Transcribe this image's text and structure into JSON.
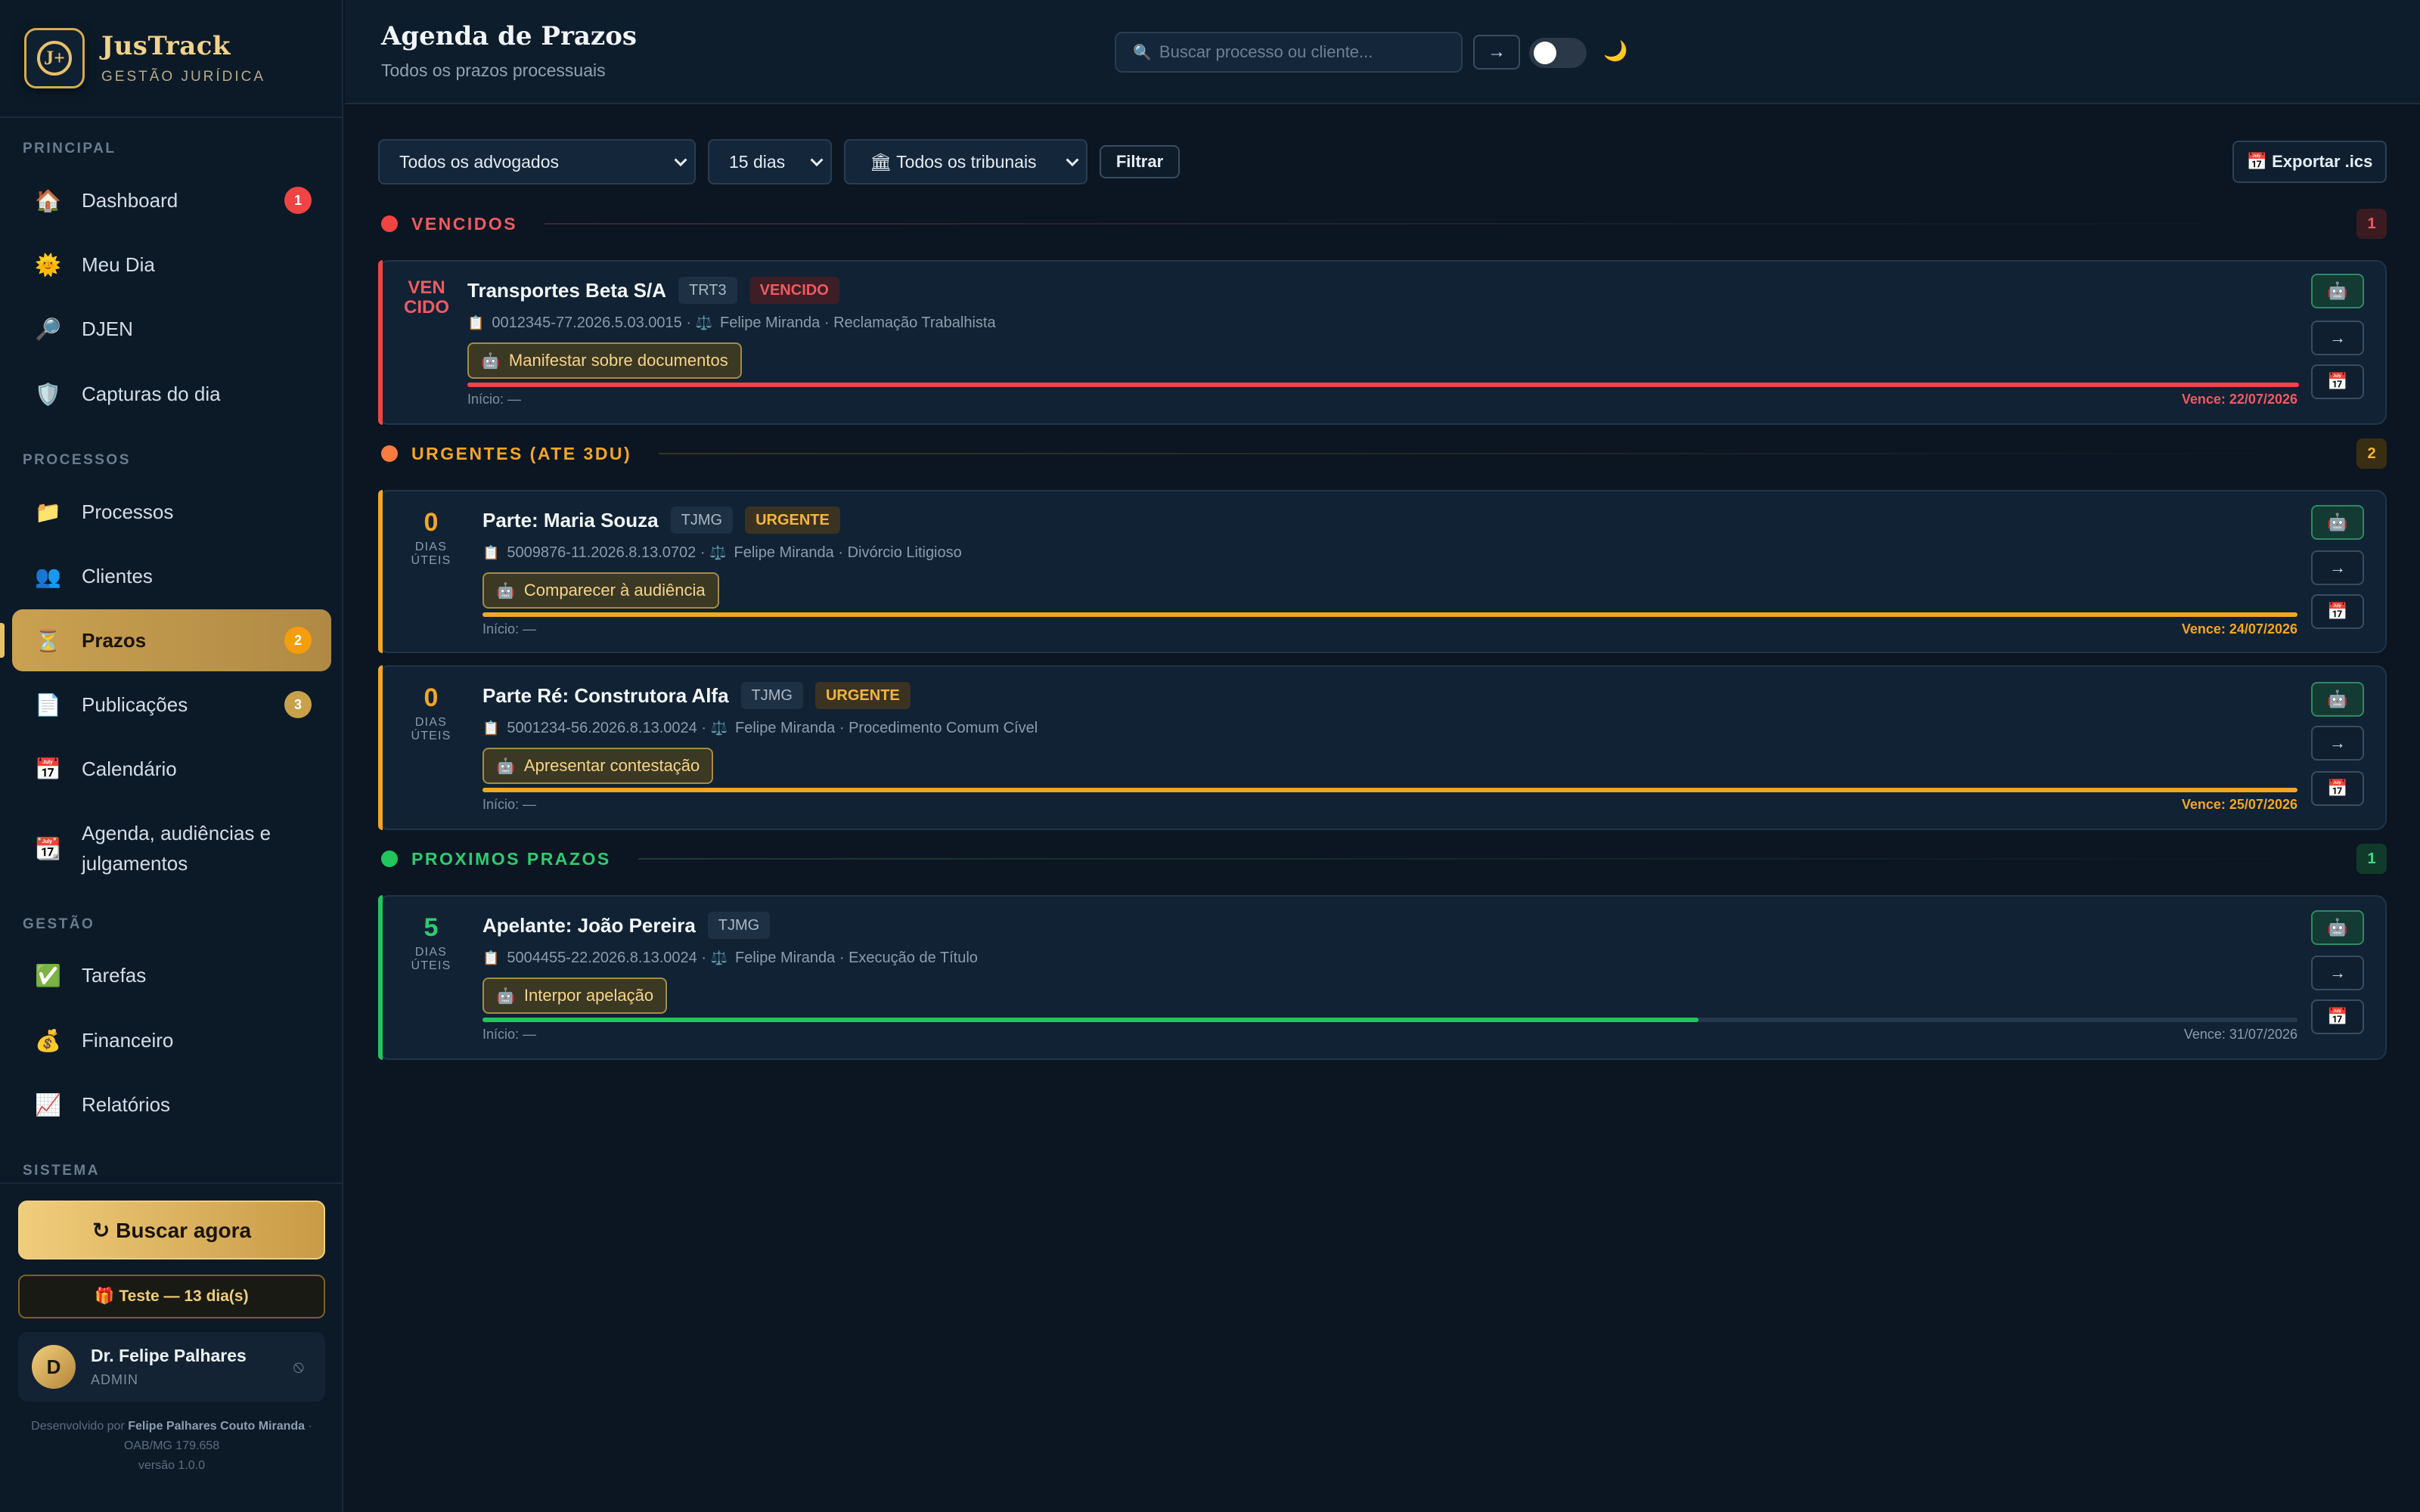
{
  "app": {
    "name": "JusTrack",
    "subtitle": "GESTÃO JURÍDICA",
    "logo_letter": "J+"
  },
  "sidebar": {
    "sections": {
      "principal": "PRINCIPAL",
      "processos": "PROCESSOS",
      "gestao": "GESTÃO",
      "sistema": "SISTEMA"
    },
    "items": [
      {
        "label": "Dashboard",
        "icon": "home-icon",
        "glyph": "🏠",
        "badge": "1",
        "badge_color": "#ef4444"
      },
      {
        "label": "Meu Dia",
        "icon": "sun-icon",
        "glyph": "🌞"
      },
      {
        "label": "DJEN",
        "icon": "magnifier-icon",
        "glyph": "🔎"
      },
      {
        "label": "Capturas do dia",
        "icon": "shield-icon",
        "glyph": "🛡️"
      },
      {
        "label": "Processos",
        "icon": "folder-icon",
        "glyph": "📁"
      },
      {
        "label": "Clientes",
        "icon": "users-icon",
        "glyph": "👥"
      },
      {
        "label": "Prazos",
        "icon": "hourglass-icon",
        "glyph": "⏳",
        "badge": "2",
        "badge_color": "#f59e0b",
        "active": true
      },
      {
        "label": "Publicações",
        "icon": "document-icon",
        "glyph": "📄",
        "badge": "3",
        "badge_color": "#c9a14a"
      },
      {
        "label": "Calendário",
        "icon": "calendar-icon",
        "glyph": "📅"
      },
      {
        "label": "Agenda, audiências e julgamentos",
        "icon": "calendar-icon",
        "glyph": "📆"
      },
      {
        "label": "Tarefas",
        "icon": "checkbox-icon",
        "glyph": "✅"
      },
      {
        "label": "Financeiro",
        "icon": "money-bag-icon",
        "glyph": "💰"
      },
      {
        "label": "Relatórios",
        "icon": "chart-icon",
        "glyph": "📈"
      }
    ],
    "buscar_label": "↻ Buscar agora",
    "trial_label": "🎁 Teste — 13 dia(s)",
    "user": {
      "initial": "D",
      "name": "Dr. Felipe Palhares",
      "role": "ADMIN"
    },
    "credit_prefix": "Desenvolvido por ",
    "credit_name": "Felipe Palhares Couto Miranda",
    "credit_suffix": " · OAB/MG 179.658",
    "version": "versão 1.0.0"
  },
  "header": {
    "title": "Agenda de Prazos",
    "subtitle": "Todos os prazos processuais",
    "search_placeholder": "Buscar processo ou cliente...",
    "go_label": "→"
  },
  "filters": {
    "lawyer": "Todos os advogados",
    "period": "15 dias",
    "court": "🏛 Todos os tribunais",
    "filter_label": "Filtrar",
    "export_label": "📅 Exportar .ics"
  },
  "sections": [
    {
      "title": "VENCIDOS",
      "count": "1",
      "color": "#ef4444"
    },
    {
      "title": "URGENTES (ATE 3DU)",
      "count": "2",
      "color": "#f59e0b"
    },
    {
      "title": "PROXIMOS PRAZOS",
      "count": "1",
      "color": "#22c55e"
    }
  ],
  "deadlines": [
    {
      "days_label": "VEN CIDO",
      "title": "Transportes Beta S/A",
      "court": "TRT3",
      "status": "VENCIDO",
      "process": "0012345-77.2026.5.03.0015",
      "lawyer": "Felipe Miranda",
      "action_type": "Reclamação Trabalhista",
      "task": "Manifestar sobre documentos",
      "start": "Início: —",
      "due": "Vence: 22/07/2026",
      "progress": 1.0
    },
    {
      "days": "0",
      "days_unit": "DIAS ÚTEIS",
      "title": "Parte: Maria Souza",
      "court": "TJMG",
      "status": "URGENTE",
      "process": "5009876-11.2026.8.13.0702",
      "lawyer": "Felipe Miranda",
      "action_type": "Divórcio Litigioso",
      "task": "Comparecer à audiência",
      "start": "Início: —",
      "due": "Vence: 24/07/2026",
      "progress": 1.0
    },
    {
      "days": "0",
      "days_unit": "DIAS ÚTEIS",
      "title": "Parte Ré: Construtora Alfa",
      "court": "TJMG",
      "status": "URGENTE",
      "process": "5001234-56.2026.8.13.0024",
      "lawyer": "Felipe Miranda",
      "action_type": "Procedimento Comum Cível",
      "task": "Apresentar contestação",
      "start": "Início: —",
      "due": "Vence: 25/07/2026",
      "progress": 1.0
    },
    {
      "days": "5",
      "days_unit": "DIAS ÚTEIS",
      "title": "Apelante: João Pereira",
      "court": "TJMG",
      "process": "5004455-22.2026.8.13.0024",
      "lawyer": "Felipe Miranda",
      "action_type": "Execução de Título",
      "task": "Interpor apelação",
      "start": "Início: —",
      "due": "Vence: 31/07/2026",
      "progress": 0.67
    }
  ],
  "card_actions": {
    "whatsapp_icon": "whatsapp-icon",
    "open_icon": "arrow-right-icon",
    "calendar_icon": "calendar-icon"
  },
  "colors": {
    "accent_gold": "#caa151",
    "overdue": "#ef4444",
    "urgent": "#f59e0b",
    "upcoming": "#22c55e"
  }
}
